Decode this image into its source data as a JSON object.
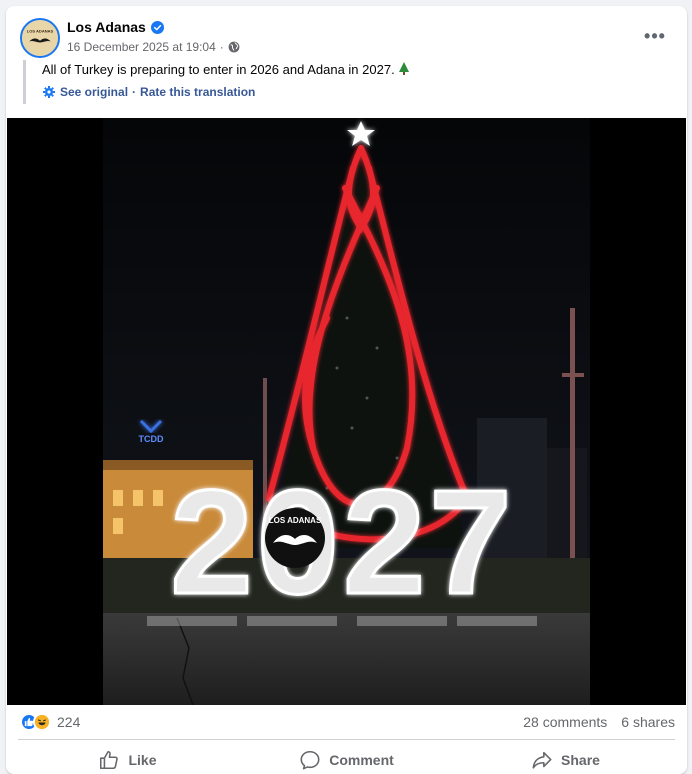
{
  "post": {
    "page_name": "Los Adanas",
    "timestamp": "16 December 2025 at 19:04",
    "separator": "·",
    "text": "All of Turkey is preparing to enter in 2026 and Adana in 2027.",
    "see_original": "See original",
    "dot": "·",
    "rate_translation": "Rate this translation",
    "more_label": "•••"
  },
  "image": {
    "sign_text": "2027",
    "logo_text": "LOS ADANAS",
    "building_sign": "TCDD"
  },
  "stats": {
    "reaction_count": "224",
    "comments": "28 comments",
    "shares": "6 shares"
  },
  "actions": {
    "like": "Like",
    "comment": "Comment",
    "share": "Share"
  },
  "colors": {
    "accent": "#1877f2",
    "secondary_text": "#65676b",
    "tree_lights": "#e8262e"
  }
}
